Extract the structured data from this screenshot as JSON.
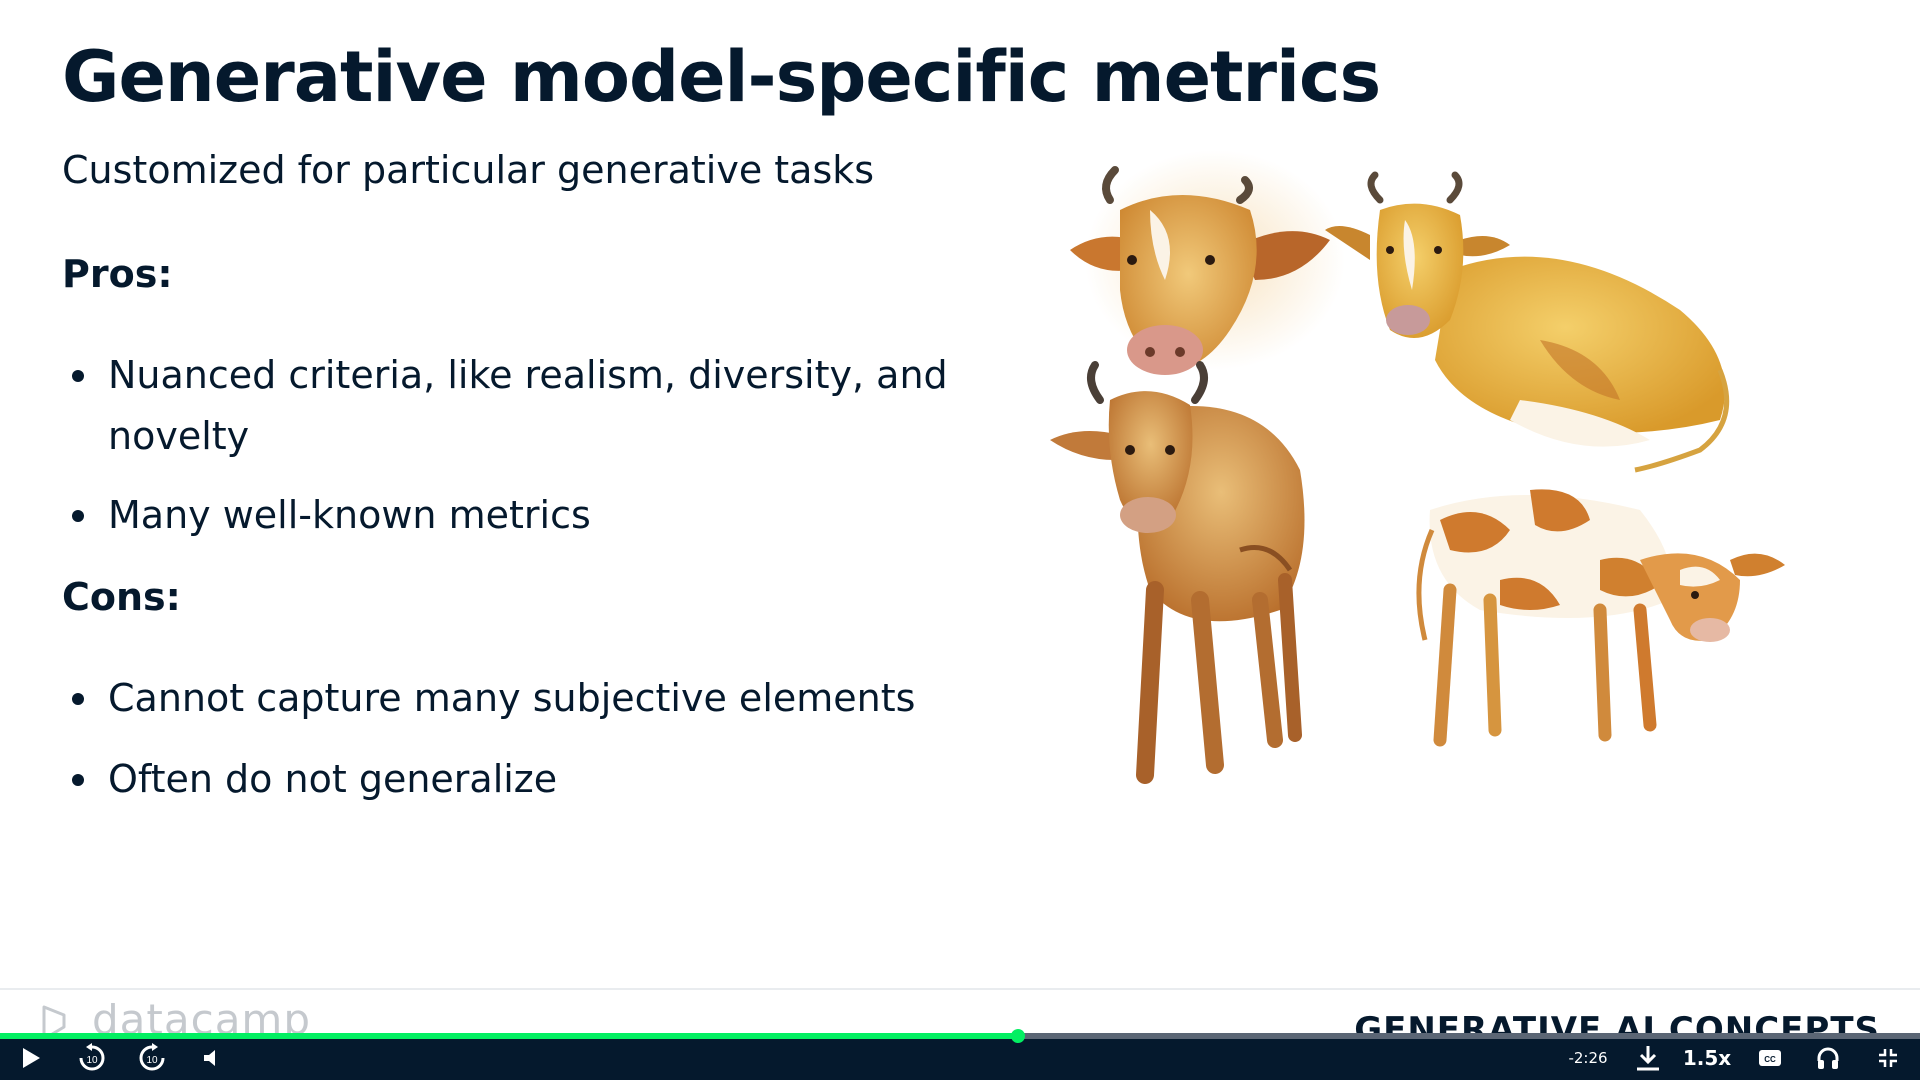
{
  "slide": {
    "title": "Generative model-specific metrics",
    "subtitle": "Customized for particular generative tasks",
    "pros_label": "Pros:",
    "pros": [
      "Nuanced criteria, like realism, diversity, and novelty",
      "Many well-known metrics"
    ],
    "cons_label": "Cons:",
    "cons": [
      "Cannot capture many subjective elements",
      "Often do not generalize"
    ]
  },
  "footer": {
    "logo_text": "datacamp",
    "course_title": "GENERATIVE AI CONCEPTS"
  },
  "player": {
    "progress": 0.53,
    "time_remaining": "-2:26",
    "speed": "1.5x",
    "skip_back_seconds": "10",
    "skip_forward_seconds": "10",
    "icons": [
      "play-icon",
      "rewind-10-icon",
      "forward-10-icon",
      "volume-icon",
      "download-icon",
      "captions-icon",
      "headphones-icon",
      "exit-fullscreen-icon"
    ],
    "colors": {
      "bar": "#05192d",
      "accent": "#03ef62",
      "track": "#5b6675"
    }
  }
}
